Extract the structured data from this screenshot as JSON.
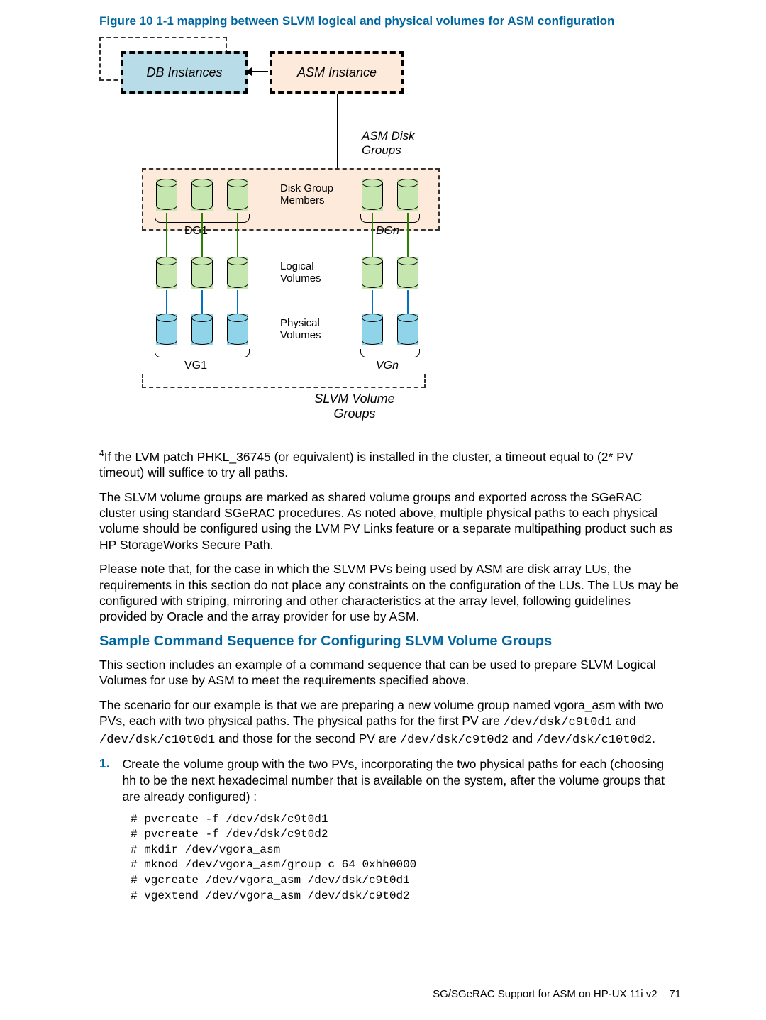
{
  "figure_caption": "Figure 10 1-1 mapping between SLVM logical and physical volumes for ASM configuration",
  "diagram": {
    "db_instances": "DB Instances",
    "asm_instance": "ASM Instance",
    "asm_disk_groups": "ASM Disk\nGroups",
    "disk_group_members": "Disk Group\nMembers",
    "dg1": "DG1",
    "dgn": "DGn",
    "logical_volumes": "Logical\nVolumes",
    "physical_volumes": "Physical\nVolumes",
    "vg1": "VG1",
    "vgn": "VGn",
    "slvm_volume_groups": "SLVM Volume\nGroups"
  },
  "footnote": {
    "marker": "4",
    "text": "If the LVM patch PHKL_36745 (or equivalent) is installed in the cluster, a timeout equal to (2* PV timeout) will suffice to try all paths."
  },
  "para_slvm": "The SLVM volume groups are marked as shared volume groups and exported across the SGeRAC cluster using standard SGeRAC procedures. As noted above, multiple physical paths to each physical volume should be configured using the LVM PV Links feature or a separate multipathing product such as HP StorageWorks Secure Path.",
  "para_note": "Please note that, for the case in which the SLVM PVs being used by ASM are disk array LUs, the requirements in this section do not place any constraints on the configuration of the LUs. The LUs may be configured with striping, mirroring and other characteristics at the array level, following guidelines provided by Oracle and the array provider for use by ASM.",
  "section_heading": "Sample Command Sequence for Configuring SLVM Volume Groups",
  "para_intro": "This section includes an example of a command sequence that can be used to prepare SLVM Logical Volumes for use by ASM to meet the requirements specified above.",
  "scenario": {
    "pre1": "The scenario for our example is that we are preparing a new volume group named vgora_asm with two PVs, each with two physical paths. The physical paths for the first PV are ",
    "path1": "/dev/dsk/c9t0d1",
    "mid1": " and ",
    "path2": "/dev/dsk/c10t0d1",
    "mid2": " and those for the second PV are ",
    "path3": "/dev/dsk/c9t0d2",
    "mid3": " and ",
    "path4": "/dev/dsk/c10t0d2",
    "post": "."
  },
  "step1": {
    "num": "1.",
    "text": "Create the volume group with the two PVs, incorporating the two physical paths for each (choosing hh to be the next hexadecimal number that is available on the system, after the volume groups that are already configured) :"
  },
  "commands": "# pvcreate -f /dev/dsk/c9t0d1\n# pvcreate -f /dev/dsk/c9t0d2\n# mkdir /dev/vgora_asm\n# mknod /dev/vgora_asm/group c 64 0xhh0000\n# vgcreate /dev/vgora_asm /dev/dsk/c9t0d1\n# vgextend /dev/vgora_asm /dev/dsk/c9t0d2",
  "footer": {
    "text": "SG/SGeRAC Support for ASM on HP-UX 11i v2",
    "page": "71"
  }
}
